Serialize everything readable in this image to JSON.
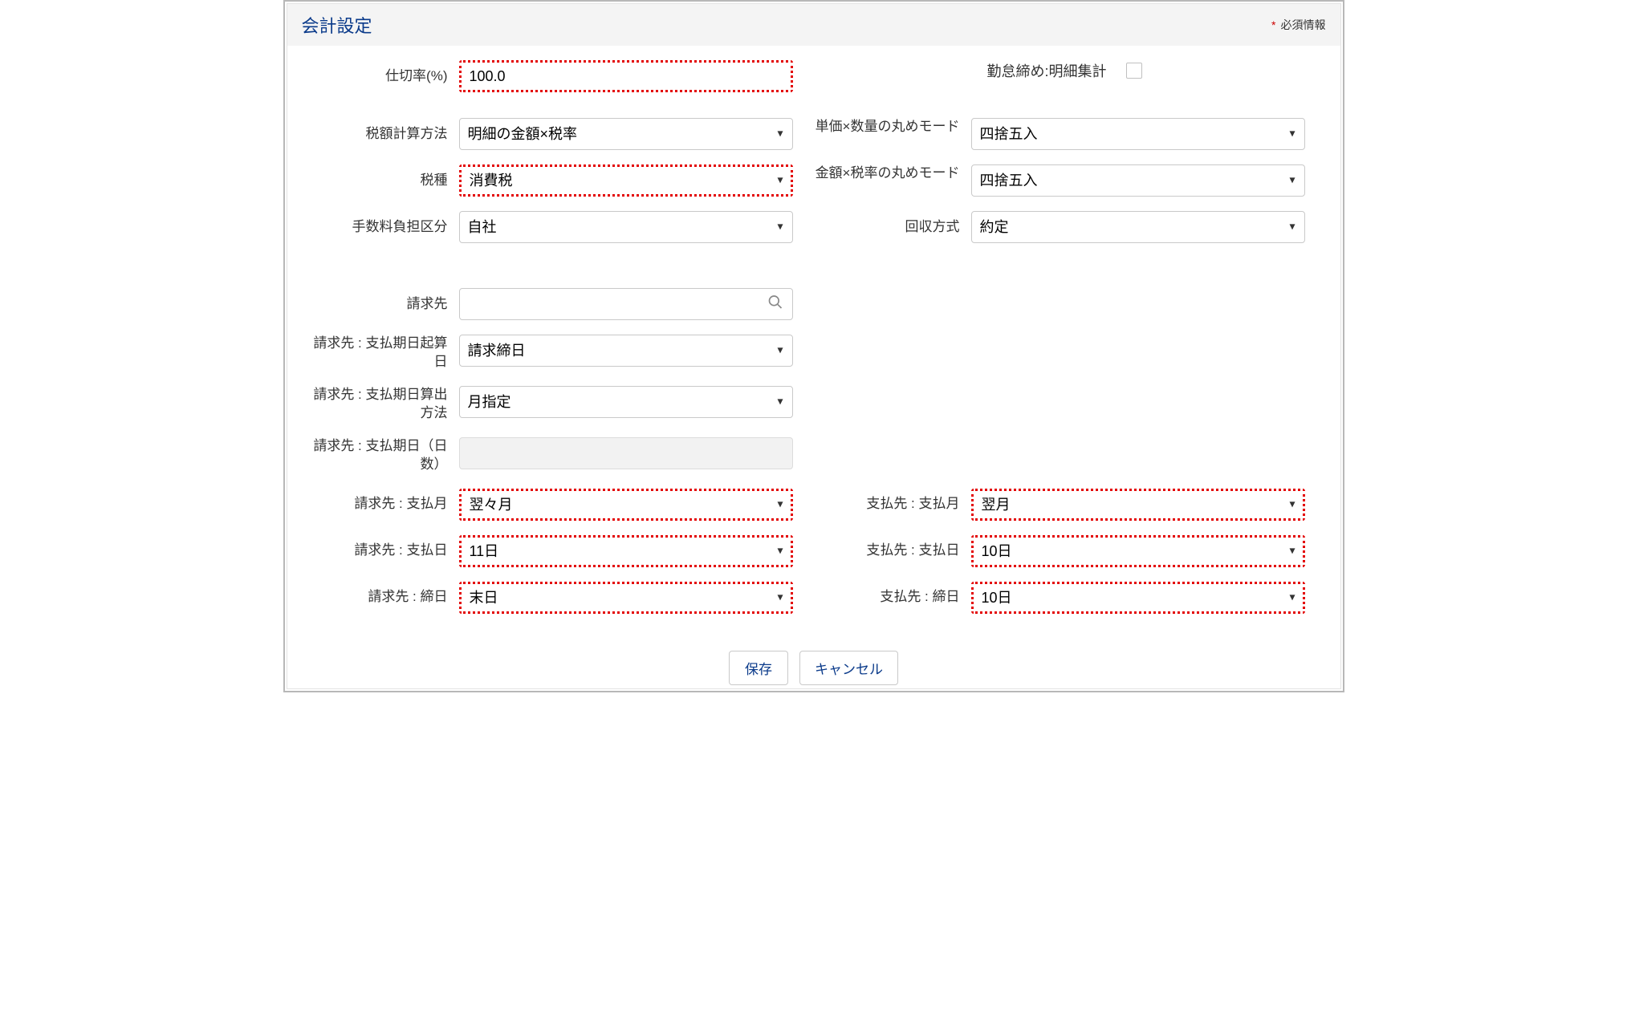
{
  "panel": {
    "title": "会計設定",
    "required_legend": "必須情報"
  },
  "fields": {
    "partition_rate": {
      "label": "仕切率(%)",
      "value": "100.0"
    },
    "attendance_detail_agg": {
      "label": "勤怠締め:明細集計",
      "checked": false
    },
    "tax_calc_method": {
      "label": "税額計算方法",
      "value": "明細の金額×税率"
    },
    "price_qty_round_mode": {
      "label": "単価×数量の丸めモード",
      "value": "四捨五入"
    },
    "tax_type": {
      "label": "税種",
      "value": "消費税"
    },
    "amount_rate_round_mode": {
      "label": "金額×税率の丸めモード",
      "value": "四捨五入"
    },
    "fee_burden": {
      "label": "手数料負担区分",
      "value": "自社"
    },
    "collection_method": {
      "label": "回収方式",
      "value": "約定"
    },
    "bill_to": {
      "label": "請求先",
      "value": ""
    },
    "bill_due_base": {
      "label": "請求先 : 支払期日起算日",
      "value": "請求締日"
    },
    "bill_due_method": {
      "label": "請求先 : 支払期日算出方法",
      "value": "月指定"
    },
    "bill_due_days": {
      "label": "請求先 : 支払期日（日数）",
      "value": ""
    },
    "bill_pay_month": {
      "label": "請求先 : 支払月",
      "value": "翌々月"
    },
    "pay_to_pay_month": {
      "label": "支払先 : 支払月",
      "value": "翌月"
    },
    "bill_pay_day": {
      "label": "請求先 : 支払日",
      "value": "11日"
    },
    "pay_to_pay_day": {
      "label": "支払先 : 支払日",
      "value": "10日"
    },
    "bill_closing_day": {
      "label": "請求先 : 締日",
      "value": "末日"
    },
    "pay_to_closing_day": {
      "label": "支払先 : 締日",
      "value": "10日"
    }
  },
  "buttons": {
    "save": "保存",
    "cancel": "キャンセル"
  }
}
